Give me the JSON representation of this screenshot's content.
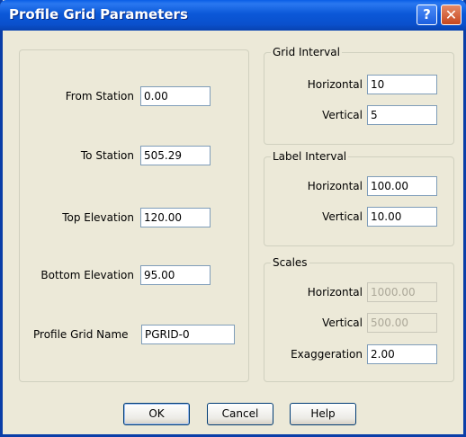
{
  "window": {
    "title": "Profile Grid Parameters",
    "help_glyph": "?",
    "close_glyph": "✕"
  },
  "left": {
    "from_station": {
      "label": "From Station",
      "value": "0.00"
    },
    "to_station": {
      "label": "To Station",
      "value": "505.29"
    },
    "top_elevation": {
      "label": "Top Elevation",
      "value": "120.00"
    },
    "bottom_elevation": {
      "label": "Bottom Elevation",
      "value": "95.00"
    },
    "grid_name": {
      "label": "Profile Grid Name",
      "value": "PGRID-0"
    }
  },
  "grid_interval": {
    "title": "Grid Interval",
    "horizontal": {
      "label": "Horizontal",
      "value": "10"
    },
    "vertical": {
      "label": "Vertical",
      "value": "5"
    }
  },
  "label_interval": {
    "title": "Label Interval",
    "horizontal": {
      "label": "Horizontal",
      "value": "100.00"
    },
    "vertical": {
      "label": "Vertical",
      "value": "10.00"
    }
  },
  "scales": {
    "title": "Scales",
    "horizontal": {
      "label": "Horizontal",
      "value": "1000.00",
      "enabled": false
    },
    "vertical": {
      "label": "Vertical",
      "value": "500.00",
      "enabled": false
    },
    "exaggeration": {
      "label": "Exaggeration",
      "value": "2.00"
    }
  },
  "buttons": {
    "ok": "OK",
    "cancel": "Cancel",
    "help": "Help"
  }
}
